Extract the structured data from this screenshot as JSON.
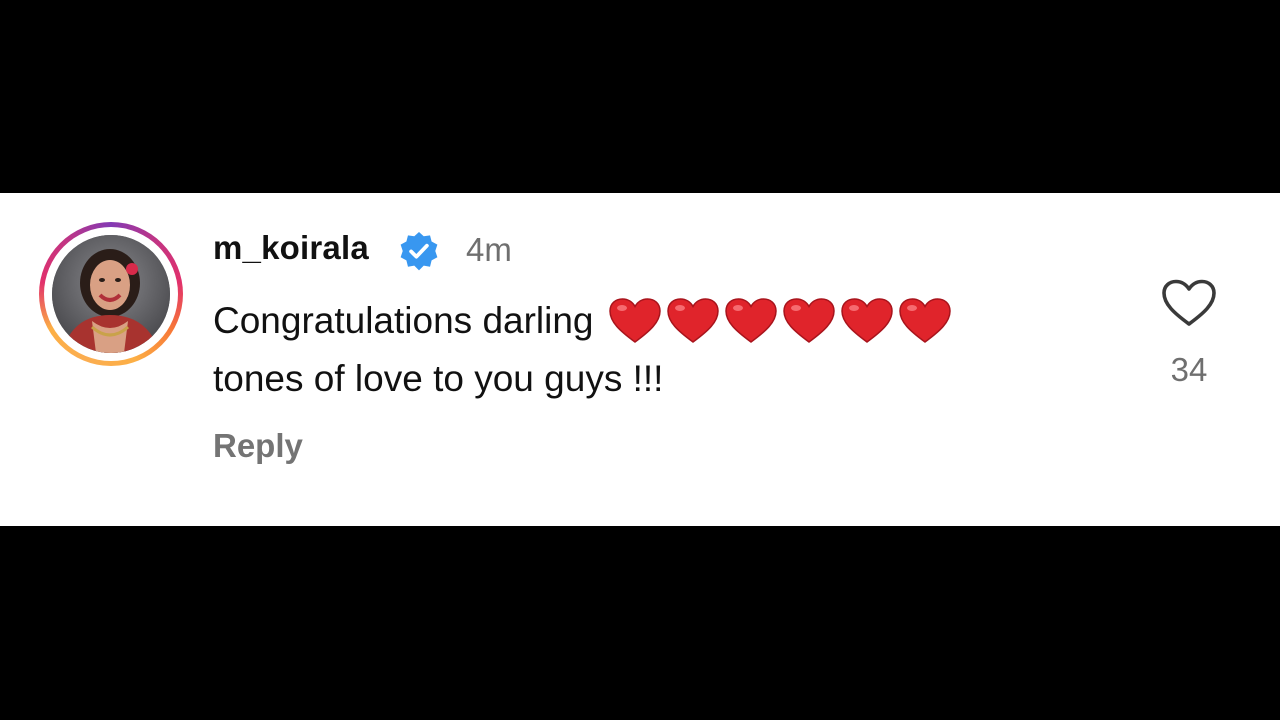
{
  "comment": {
    "username": "m_koirala",
    "verified": true,
    "time": "4m",
    "text_line1": "Congratulations darling",
    "heart_emoji_count": 6,
    "text_line2": "tones of love to you guys !!!",
    "reply_label": "Reply",
    "like_count": "34",
    "like_icon": "heart-outline-icon",
    "verified_icon": "verified-badge-icon"
  },
  "colors": {
    "background_bars": "#000000",
    "panel": "#ffffff",
    "verified_blue": "#3897f0",
    "heart_red": "#e0242b",
    "muted_text": "#6f6f6f"
  }
}
